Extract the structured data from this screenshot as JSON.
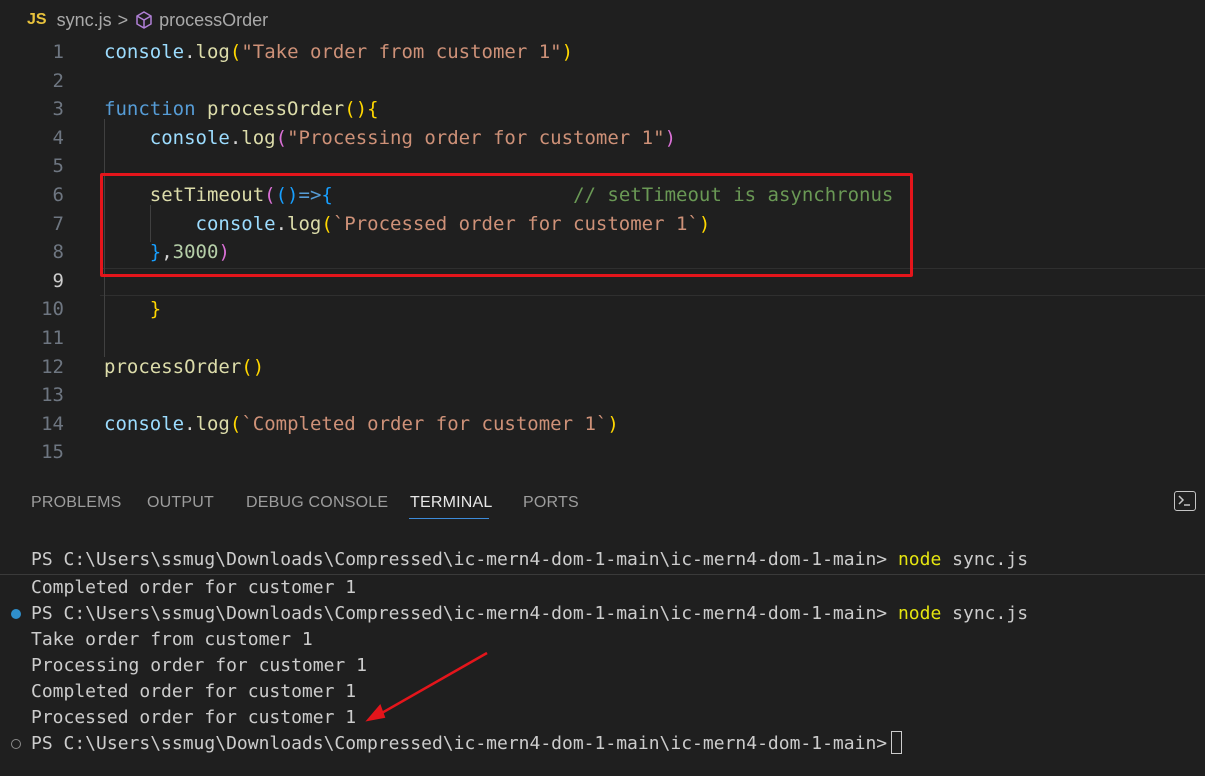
{
  "breadcrumb": {
    "file_badge": "JS",
    "file_name": "sync.js",
    "separator": ">",
    "symbol": "processOrder"
  },
  "editor": {
    "current_line": 9,
    "lines": [
      {
        "n": "1",
        "tokens": [
          [
            "var",
            "console"
          ],
          [
            "def",
            "."
          ],
          [
            "fn",
            "log"
          ],
          [
            "p1",
            "("
          ],
          [
            "str",
            "\"Take order from customer 1\""
          ],
          [
            "p1",
            ")"
          ]
        ]
      },
      {
        "n": "2",
        "tokens": []
      },
      {
        "n": "3",
        "tokens": [
          [
            "kw",
            "function"
          ],
          [
            "def",
            " "
          ],
          [
            "fn",
            "processOrder"
          ],
          [
            "p1",
            "()"
          ],
          [
            "p1",
            "{"
          ]
        ]
      },
      {
        "n": "4",
        "tokens": [
          [
            "def",
            "    "
          ],
          [
            "var",
            "console"
          ],
          [
            "def",
            "."
          ],
          [
            "fn",
            "log"
          ],
          [
            "p2",
            "("
          ],
          [
            "str",
            "\"Processing order for customer 1\""
          ],
          [
            "p2",
            ")"
          ]
        ]
      },
      {
        "n": "5",
        "tokens": []
      },
      {
        "n": "6",
        "tokens": [
          [
            "def",
            "    "
          ],
          [
            "fn",
            "setTimeout"
          ],
          [
            "p2",
            "("
          ],
          [
            "p3",
            "()"
          ],
          [
            "kw",
            "=>"
          ],
          [
            "p3",
            "{"
          ],
          [
            "def",
            "                     "
          ],
          [
            "com",
            "// setTimeout is asynchronus"
          ]
        ]
      },
      {
        "n": "7",
        "tokens": [
          [
            "def",
            "        "
          ],
          [
            "var",
            "console"
          ],
          [
            "def",
            "."
          ],
          [
            "fn",
            "log"
          ],
          [
            "p1",
            "("
          ],
          [
            "str",
            "`Processed order for customer 1`"
          ],
          [
            "p1",
            ")"
          ]
        ]
      },
      {
        "n": "8",
        "tokens": [
          [
            "def",
            "    "
          ],
          [
            "p3",
            "}"
          ],
          [
            "def",
            ","
          ],
          [
            "num",
            "3000"
          ],
          [
            "p2",
            ")"
          ]
        ]
      },
      {
        "n": "9",
        "tokens": []
      },
      {
        "n": "10",
        "tokens": [
          [
            "def",
            "    "
          ],
          [
            "p1",
            "}"
          ]
        ]
      },
      {
        "n": "11",
        "tokens": []
      },
      {
        "n": "12",
        "tokens": [
          [
            "fn",
            "processOrder"
          ],
          [
            "p1",
            "()"
          ]
        ]
      },
      {
        "n": "13",
        "tokens": []
      },
      {
        "n": "14",
        "tokens": [
          [
            "var",
            "console"
          ],
          [
            "def",
            "."
          ],
          [
            "fn",
            "log"
          ],
          [
            "p1",
            "("
          ],
          [
            "str",
            "`Completed order for customer 1`"
          ],
          [
            "p1",
            ")"
          ]
        ]
      },
      {
        "n": "15",
        "tokens": []
      }
    ]
  },
  "panel": {
    "tabs": [
      "PROBLEMS",
      "OUTPUT",
      "DEBUG CONSOLE",
      "TERMINAL",
      "PORTS"
    ],
    "active_tab": "TERMINAL"
  },
  "terminal": {
    "prompt": "PS C:\\Users\\ssmug\\Downloads\\Compressed\\ic-mern4-dom-1-main\\ic-mern4-dom-1-main>",
    "cmd_word": "node",
    "cmd_arg": "sync.js",
    "output_first": [
      "Completed order for customer 1"
    ],
    "output_second": [
      "Take order from customer 1",
      "Processing order for customer 1",
      "Completed order for customer 1",
      "Processed order for customer 1"
    ]
  },
  "colors": {
    "highlight_box": "#e4151b",
    "arrow": "#e4151b",
    "terminal_command": "#e5e510"
  }
}
